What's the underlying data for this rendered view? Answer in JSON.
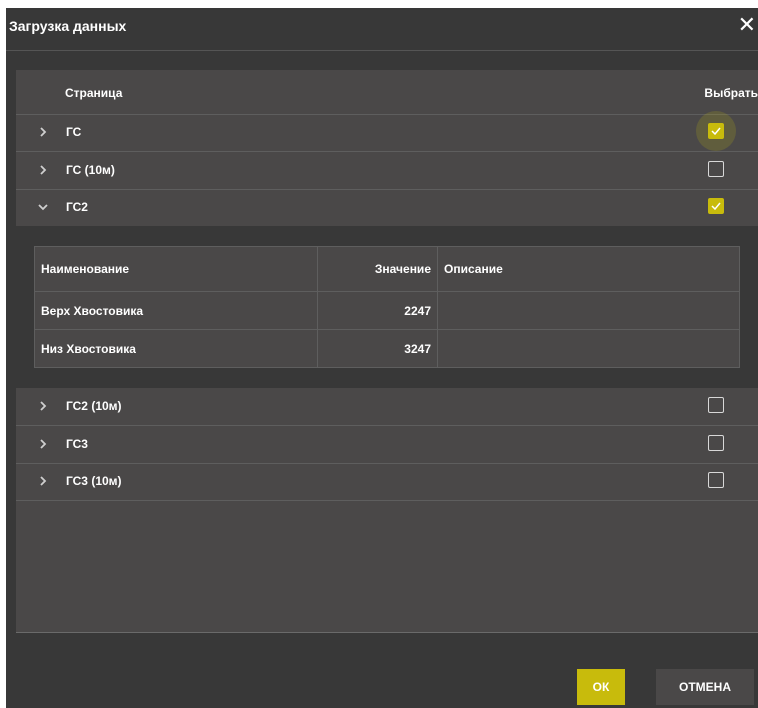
{
  "dialog": {
    "title": "Загрузка данных",
    "close_glyph": "✕"
  },
  "table": {
    "col_page": "Страница",
    "col_select": "Выбрать",
    "rows": [
      {
        "name": "ГС",
        "expanded": false,
        "checked": true
      },
      {
        "name": "ГС (10м)",
        "expanded": false,
        "checked": false
      },
      {
        "name": "ГС2",
        "expanded": true,
        "checked": true
      },
      {
        "name": "ГС2 (10м)",
        "expanded": false,
        "checked": false
      },
      {
        "name": "ГС3",
        "expanded": false,
        "checked": false
      },
      {
        "name": "ГС3 (10м)",
        "expanded": false,
        "checked": false
      }
    ]
  },
  "detail": {
    "headers": {
      "name": "Наименование",
      "value": "Значение",
      "description": "Описание"
    },
    "rows": [
      {
        "name": "Верх Хвостовика",
        "value": "2247",
        "description": ""
      },
      {
        "name": "Низ Хвостовика",
        "value": "3247",
        "description": ""
      }
    ]
  },
  "buttons": {
    "ok": "ОК",
    "cancel": "ОТМЕНА"
  },
  "colors": {
    "accent": "#c8bb0c",
    "background": "#383838",
    "panel": "#4a4848"
  }
}
